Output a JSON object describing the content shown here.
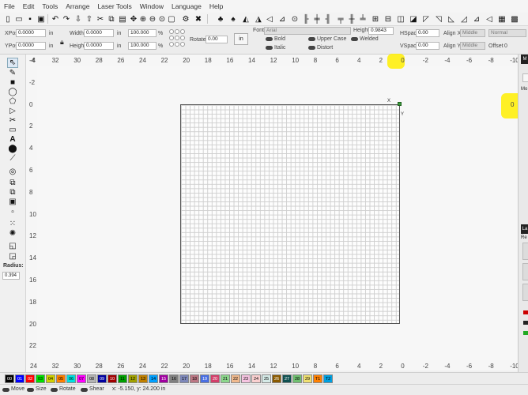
{
  "menu": [
    "File",
    "Edit",
    "Tools",
    "Arrange",
    "Laser Tools",
    "Window",
    "Language",
    "Help"
  ],
  "properties": {
    "xpos_label": "XPos",
    "xpos_value": "0.0000",
    "xpos_unit": "in",
    "ypos_label": "YPos",
    "ypos_value": "0.0000",
    "ypos_unit": "in",
    "width_label": "Width",
    "width_value": "0.0000",
    "width_unit": "in",
    "height_label": "Height",
    "height_value": "0.0000",
    "height_unit": "in",
    "scale_w": "100.000",
    "scale_h": "100.000",
    "scale_unit": "%",
    "rotate_label": "Rotate",
    "rotate_value": "0.00",
    "in_button": "in",
    "font_label": "Font",
    "font_value": "Arial",
    "font_height_label": "Height",
    "font_height_value": "0.9843",
    "bold": "Bold",
    "italic": "Italic",
    "upper_case": "Upper Case",
    "distort": "Distort",
    "welded": "Welded",
    "hspace_label": "HSpace",
    "hspace_value": "0.00",
    "vspace_label": "VSpace",
    "vspace_value": "0.00",
    "align_x_label": "Align X",
    "align_x_value": "Middle",
    "align_y_label": "Align Y",
    "align_y_value": "Middle",
    "normal_value": "Normal",
    "offset_label": "Offset",
    "offset_value": "0"
  },
  "left_tools": {
    "radius_label": "Radius:",
    "radius_value": "0.394"
  },
  "rulers": {
    "top": [
      "-4",
      "32",
      "30",
      "28",
      "26",
      "24",
      "22",
      "20",
      "18",
      "16",
      "14",
      "12",
      "10",
      "8",
      "6",
      "4",
      "2",
      "0",
      "-2",
      "-4",
      "-6",
      "-8",
      "-10"
    ],
    "bottom": [
      "24",
      "32",
      "30",
      "28",
      "26",
      "24",
      "22",
      "20",
      "18",
      "16",
      "14",
      "12",
      "10",
      "8",
      "6",
      "4",
      "2",
      "0",
      "-2",
      "-4",
      "-6",
      "-8",
      "-10"
    ],
    "left": [
      "-4",
      "-2",
      "0",
      "2",
      "4",
      "6",
      "8",
      "10",
      "12",
      "14",
      "16",
      "18",
      "20",
      "22"
    ],
    "right_zero": "0"
  },
  "canvas": {
    "x_marker": "X",
    "y_marker": "Y"
  },
  "right_panel": {
    "tab_top": "M",
    "tab_mid": "Mo",
    "tab_layers": "La",
    "tab_re": "Re"
  },
  "palette": [
    {
      "label": "00",
      "color": "#000000",
      "text": "#ffffff"
    },
    {
      "label": "01",
      "color": "#0000ff",
      "text": "#ffffff"
    },
    {
      "label": "02",
      "color": "#ff0000",
      "text": "#ffffff"
    },
    {
      "label": "03",
      "color": "#00e000",
      "text": "#000000"
    },
    {
      "label": "04",
      "color": "#d0d000",
      "text": "#000000"
    },
    {
      "label": "05",
      "color": "#ff8000",
      "text": "#000000"
    },
    {
      "label": "06",
      "color": "#00e0e0",
      "text": "#000000"
    },
    {
      "label": "07",
      "color": "#ff00ff",
      "text": "#000000"
    },
    {
      "label": "08",
      "color": "#b4b4b4",
      "text": "#000000"
    },
    {
      "label": "09",
      "color": "#0000a0",
      "text": "#ffffff"
    },
    {
      "label": "10",
      "color": "#a00000",
      "text": "#ffffff"
    },
    {
      "label": "11",
      "color": "#00a000",
      "text": "#000000"
    },
    {
      "label": "12",
      "color": "#a0a000",
      "text": "#000000"
    },
    {
      "label": "13",
      "color": "#c08000",
      "text": "#000000"
    },
    {
      "label": "14",
      "color": "#00a0ff",
      "text": "#000000"
    },
    {
      "label": "15",
      "color": "#a000a0",
      "text": "#ffffff"
    },
    {
      "label": "16",
      "color": "#808080",
      "text": "#000000"
    },
    {
      "label": "17",
      "color": "#7d87b9",
      "text": "#000000"
    },
    {
      "label": "18",
      "color": "#bb7784",
      "text": "#000000"
    },
    {
      "label": "19",
      "color": "#4a6fe3",
      "text": "#ffffff"
    },
    {
      "label": "20",
      "color": "#d33f6a",
      "text": "#ffffff"
    },
    {
      "label": "21",
      "color": "#8cd78c",
      "text": "#000000"
    },
    {
      "label": "22",
      "color": "#f0b98d",
      "text": "#000000"
    },
    {
      "label": "23",
      "color": "#f6c4e1",
      "text": "#000000"
    },
    {
      "label": "24",
      "color": "#fad0d0",
      "text": "#000000"
    },
    {
      "label": "25",
      "color": "#d5eae7",
      "text": "#000000"
    },
    {
      "label": "26",
      "color": "#8a5a00",
      "text": "#ffffff"
    },
    {
      "label": "27",
      "color": "#0f5050",
      "text": "#ffffff"
    },
    {
      "label": "28",
      "color": "#70c070",
      "text": "#000000"
    },
    {
      "label": "29",
      "color": "#f0e070",
      "text": "#000000"
    },
    {
      "label": "T1",
      "color": "#ff8000",
      "text": "#000000"
    },
    {
      "label": "T2",
      "color": "#00a0e0",
      "text": "#000000"
    }
  ],
  "status": {
    "move": "Move",
    "size": "Size",
    "rotate": "Rotate",
    "shear": "Shear",
    "coords": "x: -5.150, y: 24.200 in"
  },
  "colors": {
    "highlight": "#ffee00",
    "origin": "#3a9a3a"
  }
}
